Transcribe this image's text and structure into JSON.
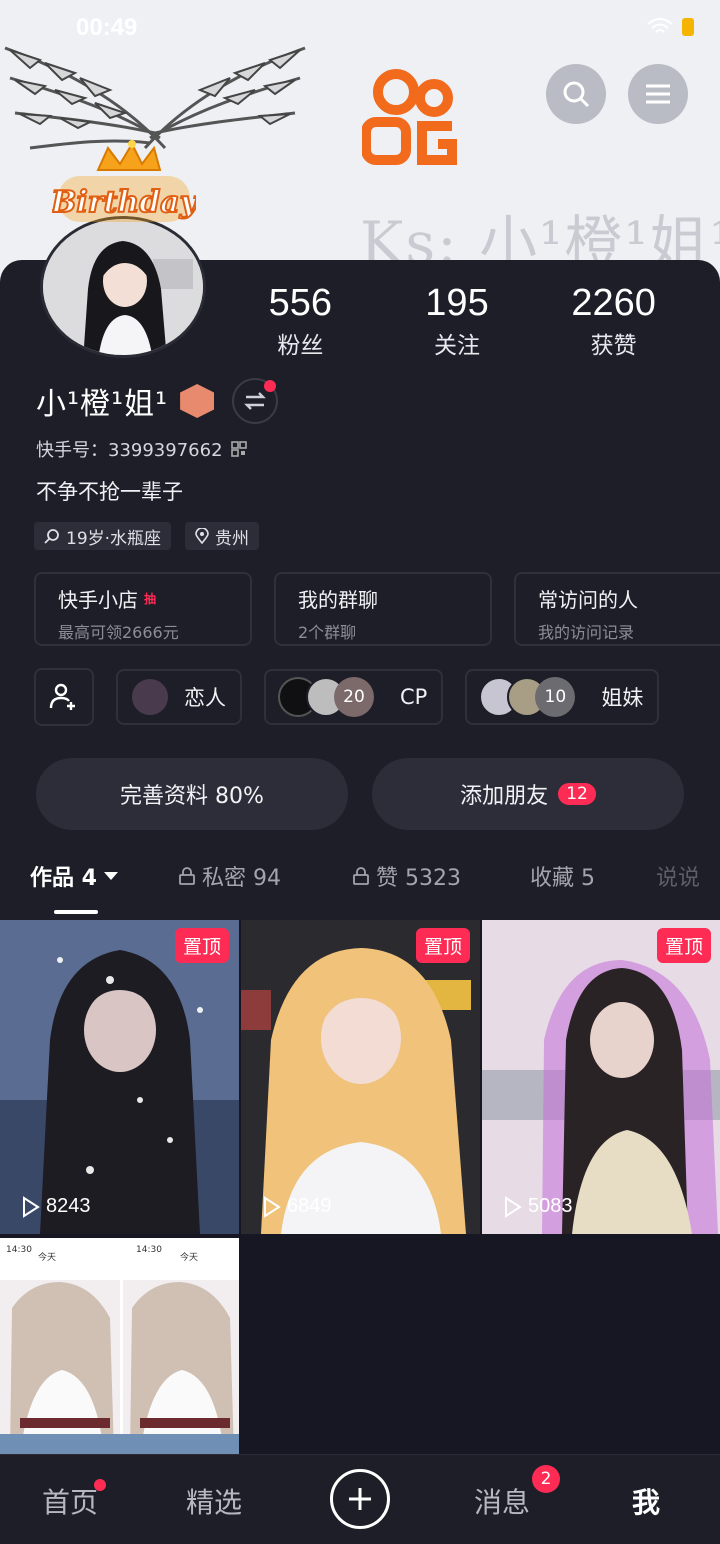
{
  "status": {
    "time": "00:49"
  },
  "cover": {
    "ks_text": "Ks: 小¹橙¹姐¹",
    "birthday_text": "Birthday"
  },
  "stats": [
    {
      "num": "556",
      "label": "粉丝"
    },
    {
      "num": "195",
      "label": "关注"
    },
    {
      "num": "2260",
      "label": "获赞"
    }
  ],
  "profile": {
    "name": "小¹橙¹姐¹",
    "ks_id": "快手号：3399397662",
    "bio": "不争不抢一辈子",
    "tags": [
      "19岁·水瓶座",
      "贵州"
    ]
  },
  "cards": [
    {
      "title": "快手小店",
      "hot": "抽",
      "sub": "最高可领2666元"
    },
    {
      "title": "我的群聊",
      "sub": "2个群聊"
    },
    {
      "title": "常访问的人",
      "sub": "我的访问记录"
    }
  ],
  "relations": [
    {
      "label": "恋人"
    },
    {
      "label": "CP",
      "count": "20"
    },
    {
      "label": "姐妹",
      "count": "10"
    }
  ],
  "actions": {
    "complete": "完善资料 80%",
    "add_friend": "添加朋友",
    "add_friend_count": "12"
  },
  "tabs": [
    "作品 4",
    "私密 94",
    "赞 5323",
    "收藏 5",
    "说说"
  ],
  "videos": [
    {
      "pin": "置顶",
      "plays": "8243"
    },
    {
      "pin": "置顶",
      "plays": "6849"
    },
    {
      "pin": "置顶",
      "plays": "5083"
    }
  ],
  "video4": {
    "time_a": "14:30",
    "time_b": "14:30",
    "today": "今天"
  },
  "nav": {
    "home": "首页",
    "featured": "精选",
    "messages": "消息",
    "messages_count": "2",
    "me": "我"
  }
}
